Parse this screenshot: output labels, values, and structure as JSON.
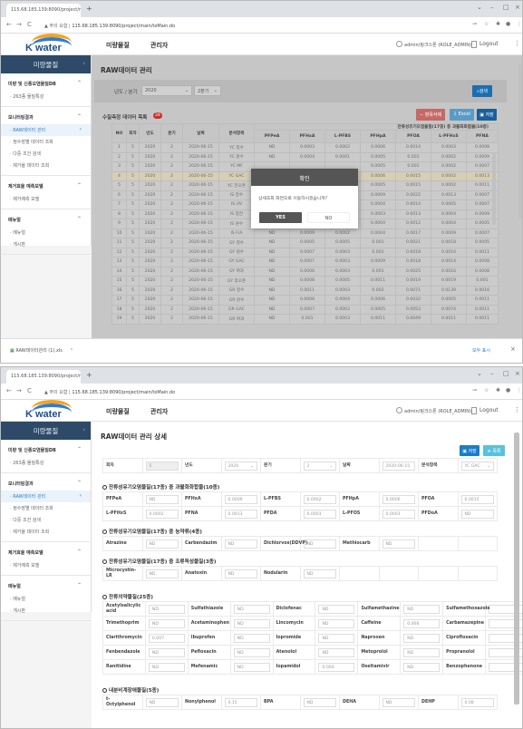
{
  "browser": {
    "tab_title": "115.68.185.139:8090/project/m...",
    "url_warning": "주의 요함",
    "url": "115.68.185.139:8090/project/main/toMain.do"
  },
  "header": {
    "logo": "K water",
    "nav": [
      "미량물질",
      "관리자"
    ],
    "user": "admin/링크스톤 (ROLE_ADMIN)",
    "logout": "Logout"
  },
  "sidebar": {
    "title": "미량물질",
    "active": "RAW데이터 관리",
    "groups": [
      {
        "label": "미량 및 신종오염물질DB",
        "items": [
          "263종 물질특성"
        ]
      },
      {
        "label": "모니터링결과",
        "items": [
          "RAW데이터 관리",
          "정수장별 데이터 조회",
          "다중 조건 검색",
          "제거율 데이터 조회"
        ]
      },
      {
        "label": "제거효율 예측모델",
        "items": [
          "제거예측 모델"
        ]
      },
      {
        "label": "메뉴얼",
        "items": [
          "메뉴얼",
          "게시판"
        ]
      }
    ]
  },
  "list_page": {
    "title": "RAW데이터 관리",
    "filter_label": "년도 / 분기",
    "year": "2020",
    "quarter": "2분기",
    "search_label": "검색",
    "list_title": "수질측정 데이터 목록",
    "count": "28",
    "delete_label": "항목삭제",
    "excel_label": "Excel",
    "save_label": "저장",
    "group_header": "잔류성유기오염물질(17종) 중 과불화화합물(10종)",
    "columns": [
      "NO",
      "회차",
      "년도",
      "분기",
      "날짜",
      "분석항목"
    ],
    "sub_columns": [
      "PFPeA",
      "PFHxA",
      "L-PFBS",
      "PFHpA",
      "PFOA",
      "L-PFHxS",
      "PFNA"
    ],
    "highlighted_row": 4,
    "rows": [
      [
        "1",
        "5",
        "2020",
        "2",
        "2020-06-15",
        "YC 정수",
        "ND",
        "0.0003",
        "0.0002",
        "0.0006",
        "0.0014",
        "0.0003",
        "0.0008"
      ],
      [
        "2",
        "5",
        "2020",
        "2",
        "2020-06-15",
        "YC 원수",
        "ND",
        "0.0004",
        "0.0001",
        "0.0005",
        "0.001",
        "0.0002",
        "0.0009"
      ],
      [
        "3",
        "5",
        "2020",
        "2",
        "2020-06-15",
        "YC MF",
        "",
        "",
        "",
        "0.0005",
        "0.001",
        "0.0002",
        "0.0007"
      ],
      [
        "4",
        "5",
        "2020",
        "2",
        "2020-06-15",
        "YC GAC",
        "",
        "",
        "",
        "0.0006",
        "0.0015",
        "0.0002",
        "0.0013"
      ],
      [
        "5",
        "5",
        "2020",
        "2",
        "2020-06-15",
        "YC 전오존",
        "",
        "",
        "",
        "0.0005",
        "0.0015",
        "0.0002",
        "0.0011"
      ],
      [
        "6",
        "5",
        "2020",
        "2",
        "2020-06-15",
        "IS 정수",
        "",
        "",
        "",
        "0.0009",
        "0.0022",
        "0.0013",
        "0.0007"
      ],
      [
        "7",
        "5",
        "2020",
        "2",
        "2020-06-15",
        "IS UV",
        "",
        "",
        "",
        "0.0004",
        "0.0014",
        "0.0005",
        "0.0007"
      ],
      [
        "8",
        "5",
        "2020",
        "2",
        "2020-06-15",
        "IS 침전",
        "",
        "",
        "",
        "0.0003",
        "0.0013",
        "0.0004",
        "0.0009"
      ],
      [
        "9",
        "5",
        "2020",
        "2",
        "2020-06-15",
        "IS 원수",
        "ND",
        "0.0003",
        "0.0002",
        "0.0004",
        "0.0012",
        "0.0004",
        "0.0005"
      ],
      [
        "10",
        "5",
        "2020",
        "2",
        "2020-06-15",
        "IS F/A",
        "ND",
        "0.0009",
        "0.0002",
        "0.0004",
        "0.0017",
        "0.0009",
        "0.0007"
      ],
      [
        "11",
        "5",
        "2020",
        "2",
        "2020-06-15",
        "GY 정수",
        "ND",
        "0.0005",
        "0.0005",
        "0.001",
        "0.0021",
        "0.0018",
        "0.0005"
      ],
      [
        "12",
        "5",
        "2020",
        "2",
        "2020-06-15",
        "GY 원수",
        "ND",
        "0.0007",
        "0.0003",
        "0.001",
        "0.0018",
        "0.0016",
        "0.0011"
      ],
      [
        "13",
        "5",
        "2020",
        "2",
        "2020-06-15",
        "GY GAC",
        "ND",
        "0.0007",
        "0.0003",
        "0.0009",
        "0.0018",
        "0.0014",
        "0.0008"
      ],
      [
        "14",
        "5",
        "2020",
        "2",
        "2020-06-15",
        "GY 여과",
        "ND",
        "0.0006",
        "0.0003",
        "0.001",
        "0.0025",
        "0.0016",
        "0.0008"
      ],
      [
        "15",
        "5",
        "2020",
        "2",
        "2020-06-15",
        "GY 후오존",
        "ND",
        "0.0008",
        "0.0005",
        "0.0011",
        "0.0019",
        "0.0019",
        "0.001"
      ],
      [
        "16",
        "5",
        "2020",
        "2",
        "2020-06-15",
        "GR 정수",
        "ND",
        "0.0011",
        "0.0003",
        "0.002",
        "0.0071",
        "0.0139",
        "0.0016"
      ],
      [
        "17",
        "5",
        "2020",
        "2",
        "2020-06-15",
        "GR 원수",
        "ND",
        "0.0006",
        "0.0004",
        "0.0006",
        "0.0032",
        "0.0005",
        "0.0011"
      ],
      [
        "18",
        "5",
        "2020",
        "2",
        "2020-06-15",
        "GR GAC",
        "ND",
        "0.0007",
        "0.0002",
        "0.0005",
        "0.0053",
        "0.0074",
        "0.0011"
      ],
      [
        "19",
        "5",
        "2020",
        "2",
        "2020-06-15",
        "GR 여과",
        "ND",
        "0.001",
        "0.0003",
        "0.0011",
        "0.0049",
        "0.0011",
        "0.0011"
      ]
    ],
    "dialog": {
      "title": "확인",
      "message": "상세조회 화면으로 이동하시겠습니까?",
      "yes": "YES",
      "no": "NO"
    },
    "download": {
      "file": "RAW데이터관리 (1).xls",
      "show_all": "모두 표시"
    }
  },
  "detail_page": {
    "title": "RAW데이터 관리 상세",
    "save_label": "저장",
    "list_label": "목록",
    "meta": [
      {
        "label": "회차",
        "value": "5"
      },
      {
        "label": "년도",
        "value": "2020"
      },
      {
        "label": "분기",
        "value": "2"
      },
      {
        "label": "날짜",
        "value": "2020-06-15"
      },
      {
        "label": "분석항목",
        "value": "YC GAC"
      }
    ],
    "sections": [
      {
        "title": "잔류성유기오염물질(17종) 중 과불화화합물(10종)",
        "rows": [
          [
            [
              "PFPeA",
              "ND"
            ],
            [
              "PFHxA",
              "0.0009"
            ],
            [
              "L-PFBS",
              "0.0002"
            ],
            [
              "PFHpA",
              "0.0006"
            ],
            [
              "PFOA",
              "0.0015"
            ]
          ],
          [
            [
              "L-PFHxS",
              "0.0002"
            ],
            [
              "PFNA",
              "0.0013"
            ],
            [
              "PFDA",
              "0.0003"
            ],
            [
              "L-PFOS",
              "0.0003"
            ],
            [
              "PFDoA",
              "ND"
            ]
          ]
        ]
      },
      {
        "title": "잔류성유기오염물질(17종) 중 농약류(4종)",
        "rows": [
          [
            [
              "Atrazine",
              "ND"
            ],
            [
              "Carbendazim",
              "ND"
            ],
            [
              "Dichlorvos(DDVP)",
              "ND"
            ],
            [
              "Methiocarb",
              "ND"
            ]
          ]
        ]
      },
      {
        "title": "잔류성유기오염물질(17종) 중 조류독성물질(3종)",
        "rows": [
          [
            [
              "Microcystin-LR",
              "ND"
            ],
            [
              "Anatoxin",
              "ND"
            ],
            [
              "Nodularin",
              "ND"
            ]
          ]
        ]
      },
      {
        "title": "잔류의약물질(25종)",
        "rows": [
          [
            [
              "Acetylsalicylic acid",
              "ND"
            ],
            [
              "Sulfathiazole",
              "ND"
            ],
            [
              "Diclofenac",
              "ND"
            ],
            [
              "Sulfamethazine",
              "ND"
            ],
            [
              "Sulfamethoxazole",
              ""
            ]
          ],
          [
            [
              "Trimethoprim",
              "ND"
            ],
            [
              "Acetaminophen",
              "ND"
            ],
            [
              "Lincomycin",
              "ND"
            ],
            [
              "Caffeine",
              "0.006"
            ],
            [
              "Carbamazepine",
              ""
            ]
          ],
          [
            [
              "Clarithromycin",
              "0.007"
            ],
            [
              "Ibuprofen",
              "ND"
            ],
            [
              "Iopromide",
              "ND"
            ],
            [
              "Naproxen",
              "ND"
            ],
            [
              "Ciprofloxacin",
              ""
            ]
          ],
          [
            [
              "Fenbendazole",
              "ND"
            ],
            [
              "Pefloxacin",
              "ND"
            ],
            [
              "Atenolol",
              "ND"
            ],
            [
              "Metoprolol",
              "ND"
            ],
            [
              "Propranolol",
              ""
            ]
          ],
          [
            [
              "Ranitidine",
              "ND"
            ],
            [
              "Mefenamic",
              "ND"
            ],
            [
              "Iopamidol",
              "0.004"
            ],
            [
              "Oseltamivir",
              "ND"
            ],
            [
              "Benzophenone",
              ""
            ]
          ]
        ]
      },
      {
        "title": "내분비계장애물질(5종)",
        "rows": [
          [
            [
              "t-Octylphenol",
              "ND"
            ],
            [
              "Nonylphenol",
              "0.15"
            ],
            [
              "BPA",
              "ND"
            ],
            [
              "DEHA",
              "ND"
            ],
            [
              "DEHP",
              "0.08"
            ]
          ]
        ]
      }
    ]
  },
  "colors": {
    "sidebar_header": "#2e4a68",
    "primary": "#1a7cc9",
    "info": "#5bc0de",
    "danger": "#d9534f",
    "badge": "#d9302c"
  }
}
